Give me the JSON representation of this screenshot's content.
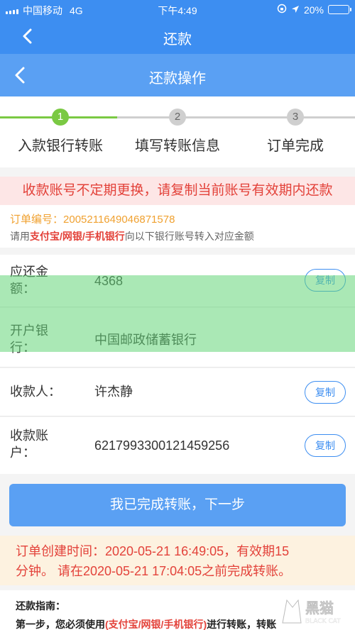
{
  "status_bar": {
    "carrier": "中国移动",
    "network": "4G",
    "time": "下午4:49",
    "battery": "20%",
    "battery_level": 0.2
  },
  "nav": {
    "top_title": "还款",
    "sub_title": "还款操作"
  },
  "steps": [
    {
      "num": "1",
      "label": "入款银行转账",
      "state": "active"
    },
    {
      "num": "2",
      "label": "填写转账信息",
      "state": "pending"
    },
    {
      "num": "3",
      "label": "订单完成",
      "state": "pending"
    }
  ],
  "warning": "收款账号不定期更换，请复制当前账号有效期内还款",
  "order": {
    "number_label": "订单编号：",
    "number": "2005211649046871578",
    "hint_prefix": "请用",
    "hint_methods": "支付宝/网银/手机银行",
    "hint_suffix": "向以下银行账号转入对应金额"
  },
  "details": {
    "amount": {
      "label": "应还金额：",
      "value": "4368"
    },
    "bank": {
      "label": "开户银行：",
      "value": "中国邮政储蓄银行"
    },
    "payee": {
      "label": "收款人：",
      "value": "许杰静"
    },
    "account": {
      "label": "收款账户：",
      "value": "6217993300121459256"
    },
    "copy_label": "复制"
  },
  "confirm_button": "我已完成转账，下一步",
  "notice": {
    "line1": "订单创建时间：2020-05-21 16:49:05，有效期15",
    "line2": "分钟。 请在2020-05-21 17:04:05之前完成转账。"
  },
  "guide": {
    "title": "还款指南：",
    "step1_prefix": "第一步，您必须使用",
    "step1_methods": "(支付宝/网银/手机银行)",
    "step1_suffix": "进行转账，转账"
  },
  "colors": {
    "primary": "#3d8ef1",
    "nav_secondary": "#5aa0f3",
    "step_active": "#7ac943",
    "alert": "#e3423a",
    "order_no": "#f0a130"
  },
  "icons": [
    "back-arrow-icon",
    "lock-rotation-icon",
    "location-arrow-icon",
    "battery-icon",
    "signal-icon"
  ],
  "watermark_logo": "黑猫 BLACK CAT"
}
